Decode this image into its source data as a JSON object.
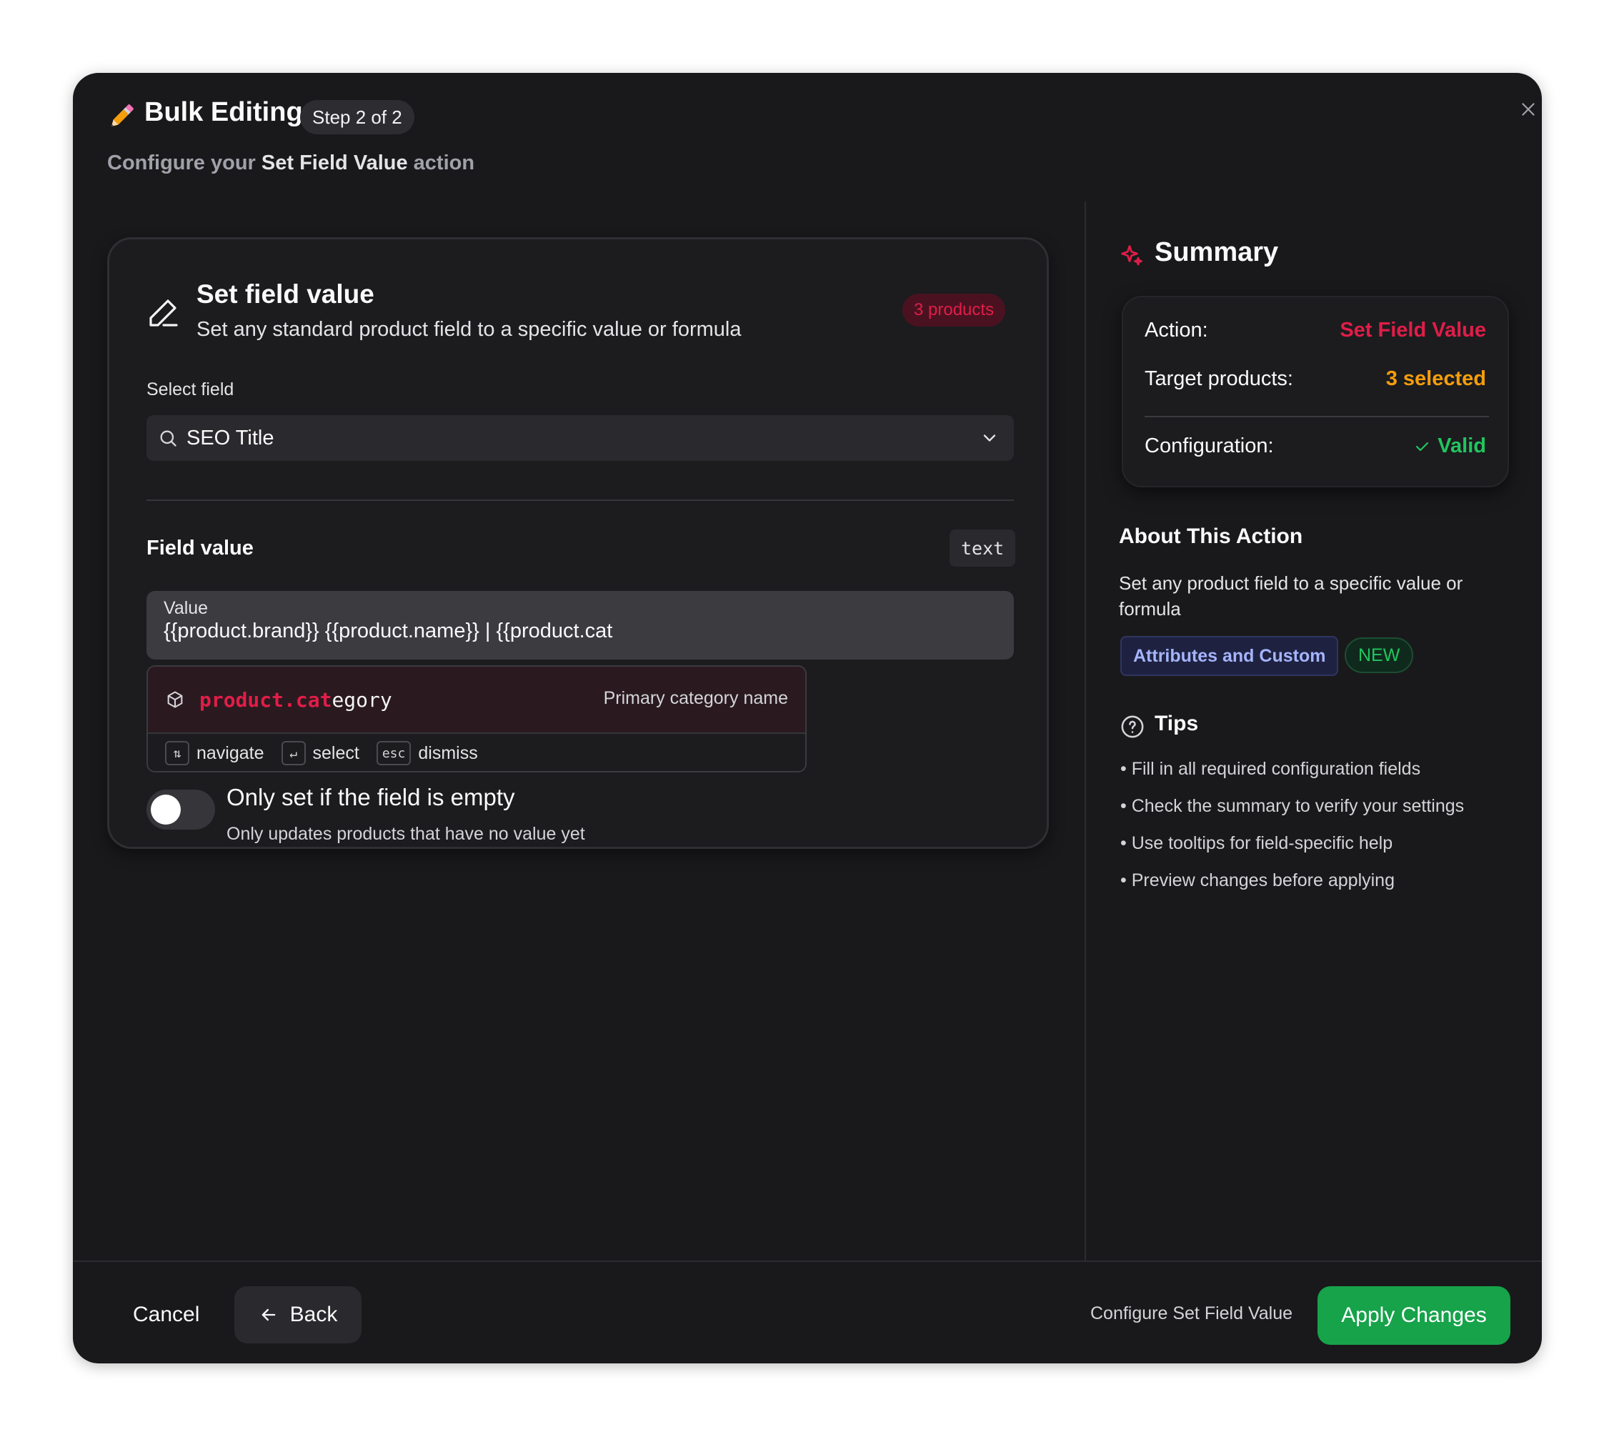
{
  "header": {
    "title": "Bulk Editing",
    "step_badge": "Step 2 of 2",
    "subtitle_prefix": "Configure your",
    "subtitle_action": "Set Field Value",
    "subtitle_suffix": "action"
  },
  "card": {
    "title": "Set field value",
    "description": "Set any standard product field to a specific value or formula",
    "products_badge": "3 products",
    "select_label": "Select field",
    "select_value": "SEO Title",
    "field_value_label": "Field value",
    "type_chip": "text",
    "value_label": "Value",
    "value_text": "{{product.brand}} {{product.name}} | {{product.cat",
    "suggestion": {
      "match": "product.cat",
      "rest": "egory",
      "description": "Primary category name"
    },
    "hints": [
      {
        "key": "⇅",
        "label": "navigate"
      },
      {
        "key": "↵",
        "label": "select"
      },
      {
        "key": "esc",
        "label": "dismiss"
      }
    ],
    "toggle_title": "Only set if the field is empty",
    "toggle_desc": "Only updates products that have no value yet",
    "toggle_on": false
  },
  "summary": {
    "title": "Summary",
    "rows": [
      {
        "label": "Action:",
        "value": "Set Field Value",
        "color": "#e11d48"
      },
      {
        "label": "Target products:",
        "value": "3 selected",
        "color": "#f59e0b"
      },
      {
        "label": "Configuration:",
        "value": "Valid",
        "color": "#22c55e"
      }
    ]
  },
  "about": {
    "title": "About This Action",
    "description": "Set any product field to a specific value or formula",
    "tag": "Attributes and Custom",
    "new_badge": "NEW"
  },
  "tips": {
    "title": "Tips",
    "items": [
      "Fill in all required configuration fields",
      "Check the summary to verify your settings",
      "Use tooltips for field-specific help",
      "Preview changes before applying"
    ]
  },
  "footer": {
    "cancel": "Cancel",
    "back": "Back",
    "hint": "Configure Set Field Value",
    "apply": "Apply Changes"
  },
  "colors": {
    "accent_red": "#e11d48",
    "accent_amber": "#f59e0b",
    "accent_green": "#22c55e",
    "apply_green": "#16a34a"
  }
}
